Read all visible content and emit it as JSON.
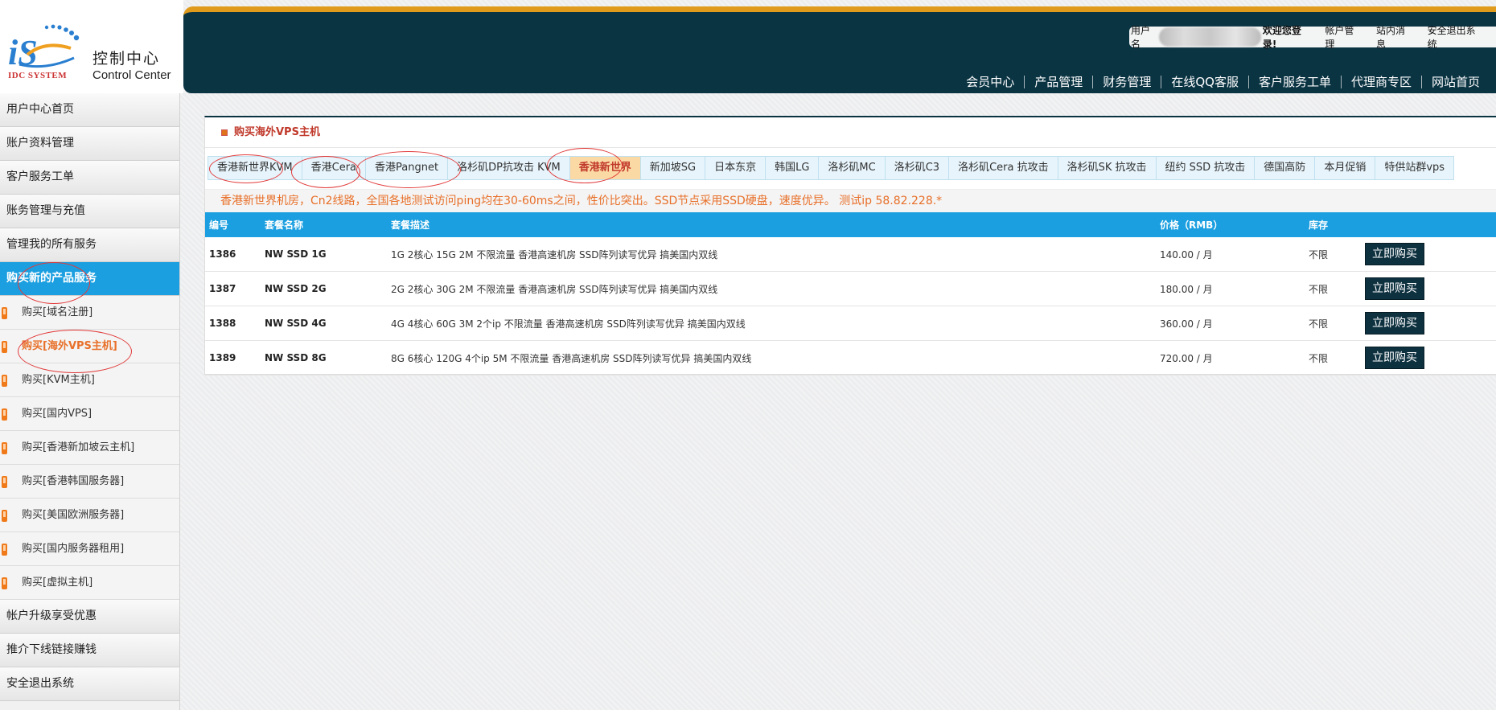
{
  "logo": {
    "title": "控制中心",
    "subtitle": "Control Center",
    "badge": "IDC SYSTEM"
  },
  "userbar": {
    "label": "用户名",
    "welcome": "欢迎您登录!",
    "links": [
      "帐户管理",
      "站内消息",
      "安全退出系统"
    ]
  },
  "main_nav": [
    "会员中心",
    "产品管理",
    "财务管理",
    "在线QQ客服",
    "客户服务工单",
    "代理商专区",
    "网站首页"
  ],
  "sidebar": {
    "top_items": [
      "用户中心首页",
      "账户资料管理",
      "客户服务工单",
      "账务管理与充值",
      "管理我的所有服务"
    ],
    "active_item": "购买新的产品服务",
    "sub_items": [
      "购买[域名注册]",
      "购买[海外VPS主机]",
      "购买[KVM主机]",
      "购买[国内VPS]",
      "购买[香港新加坡云主机]",
      "购买[香港韩国服务器]",
      "购买[美国欧洲服务器]",
      "购买[国内服务器租用]",
      "购买[虚拟主机]"
    ],
    "bottom_items": [
      "帐户升级享受优惠",
      "推介下线链接赚钱",
      "安全退出系统"
    ]
  },
  "panel": {
    "title": "购买海外VPS主机",
    "tabs": [
      "香港新世界KVM",
      "香港Cera",
      "香港Pangnet",
      "洛杉矶DP抗攻击 KVM",
      "香港新世界",
      "新加坡SG",
      "日本东京",
      "韩国LG",
      "洛杉矶MC",
      "洛杉矶C3",
      "洛杉矶Cera 抗攻击",
      "洛杉矶SK 抗攻击",
      "纽约 SSD 抗攻击",
      "德国高防",
      "本月促销",
      "特供站群vps"
    ],
    "active_tab": "香港新世界",
    "notice": "香港新世界机房，Cn2线路，全国各地测试访问ping均在30-60ms之间，性价比突出。SSD节点采用SSD硬盘，速度优异。 测试ip 58.82.228.*",
    "columns": [
      "编号",
      "套餐名称",
      "套餐描述",
      "价格（RMB）",
      "库存",
      ""
    ],
    "rows": [
      {
        "id": "1386",
        "name": "NW SSD 1G",
        "desc": "1G 2核心 15G 2M 不限流量 香港高速机房 SSD阵列读写优异 搞美国内双线",
        "price": "140.00 / 月",
        "stock": "不限",
        "action": "立即购买"
      },
      {
        "id": "1387",
        "name": "NW SSD 2G",
        "desc": "2G 2核心 30G 2M 不限流量 香港高速机房 SSD阵列读写优异 搞美国内双线",
        "price": "180.00 / 月",
        "stock": "不限",
        "action": "立即购买"
      },
      {
        "id": "1388",
        "name": "NW SSD 4G",
        "desc": "4G 4核心 60G 3M 2个ip 不限流量 香港高速机房 SSD阵列读写优异 搞美国内双线",
        "price": "360.00 / 月",
        "stock": "不限",
        "action": "立即购买"
      },
      {
        "id": "1389",
        "name": "NW SSD 8G",
        "desc": "8G 6核心 120G 4个ip 5M 不限流量 香港高速机房 SSD阵列读写优异 搞美国内双线",
        "price": "720.00 / 月",
        "stock": "不限",
        "action": "立即购买"
      }
    ]
  },
  "colors": {
    "header_bg": "#0b3443",
    "accent_orange": "#e09a1c",
    "active_blue": "#1b9fe0",
    "notice_orange": "#e8702a",
    "annotation_red": "#e23a3a"
  }
}
